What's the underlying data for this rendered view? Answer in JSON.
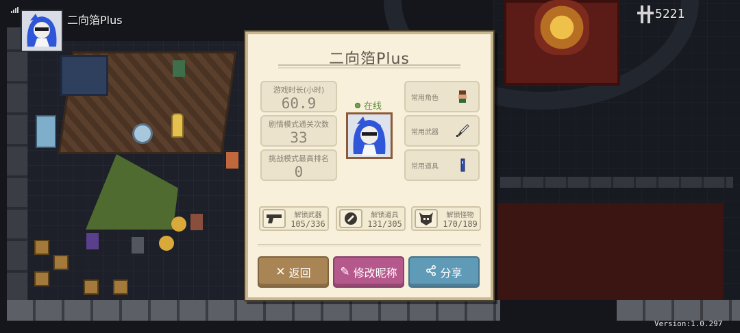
{
  "hud": {
    "player_name": "二向箔Plus",
    "gem_count": "5221",
    "version": "Version:1.0.297"
  },
  "dialog": {
    "title": "二向箔Plus",
    "stats": [
      {
        "label": "游戏时长(小时)",
        "value": "60.9"
      },
      {
        "label": "剧情模式通关次数",
        "value": "33"
      },
      {
        "label": "挑战模式最高排名",
        "value": "0"
      }
    ],
    "status": "在线",
    "favorites": [
      {
        "label": "常用角色",
        "icon": "character-icon"
      },
      {
        "label": "常用武器",
        "icon": "sword-icon"
      },
      {
        "label": "常用道具",
        "icon": "item-icon"
      }
    ],
    "unlocks": [
      {
        "label": "解锁武器",
        "count": "105/336",
        "icon": "pistol-icon"
      },
      {
        "label": "解锁道具",
        "count": "131/305",
        "icon": "shield-item-icon"
      },
      {
        "label": "解锁怪物",
        "count": "170/189",
        "icon": "monster-icon"
      }
    ],
    "buttons": {
      "back": "返回",
      "rename": "修改昵称",
      "share": "分享"
    }
  },
  "colors": {
    "panel_bg": "#f8f0da",
    "back_button": "#a98556",
    "rename_button": "#b5588c",
    "share_button": "#5f9ab7",
    "online_green": "#5f8f3e"
  }
}
